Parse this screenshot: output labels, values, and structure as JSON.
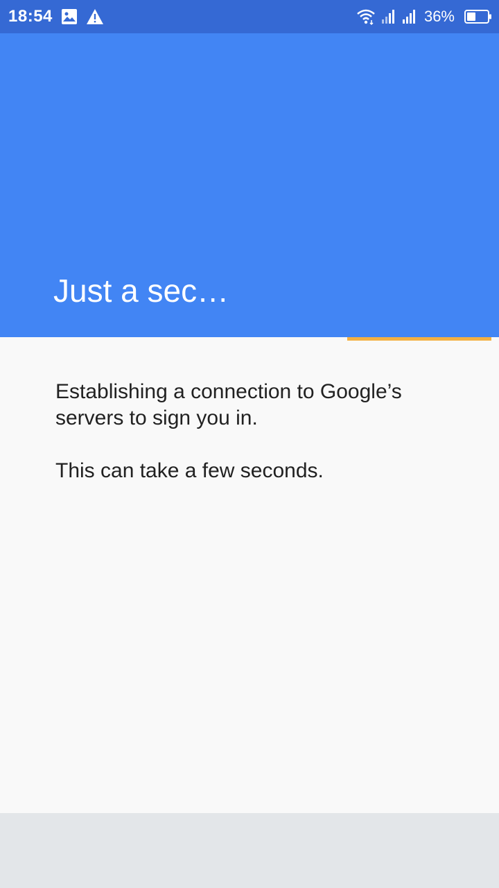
{
  "status_bar": {
    "time": "18:54",
    "battery": "36%",
    "icons": [
      "image-icon",
      "warning-icon",
      "wifi-icon",
      "signal-icon",
      "signal-icon",
      "battery-icon"
    ],
    "background": "#3569d4"
  },
  "header": {
    "title": "Just a sec…",
    "background": "#4285f4"
  },
  "progress": {
    "color": "#f4b042",
    "indeterminate": true
  },
  "content": {
    "paragraph_1": "Establishing a connection to Google’s servers to sign you in.",
    "paragraph_2": "This can take a few seconds."
  },
  "colors": {
    "page_background": "#f9f9f9",
    "text": "#212121",
    "bottom_bar": "#e3e6e9"
  }
}
